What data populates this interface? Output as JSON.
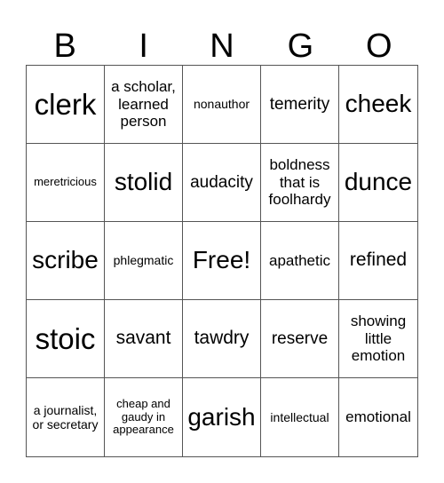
{
  "header": {
    "letters": [
      "B",
      "I",
      "N",
      "G",
      "O"
    ]
  },
  "grid": {
    "rows": [
      [
        "clerk",
        "a scholar, learned person",
        "nonauthor",
        "temerity",
        "cheek"
      ],
      [
        "meretricious",
        "stolid",
        "audacity",
        "boldness that is foolhardy",
        "dunce"
      ],
      [
        "scribe",
        "phlegmatic",
        "Free!",
        "apathetic",
        "refined"
      ],
      [
        "stoic",
        "savant",
        "tawdry",
        "reserve",
        "showing little emotion"
      ],
      [
        "a journalist, or secretary",
        "cheap and gaudy in appearance",
        "garish",
        "intellectual",
        "emotional"
      ]
    ],
    "free_space": {
      "row": 2,
      "col": 2
    }
  }
}
